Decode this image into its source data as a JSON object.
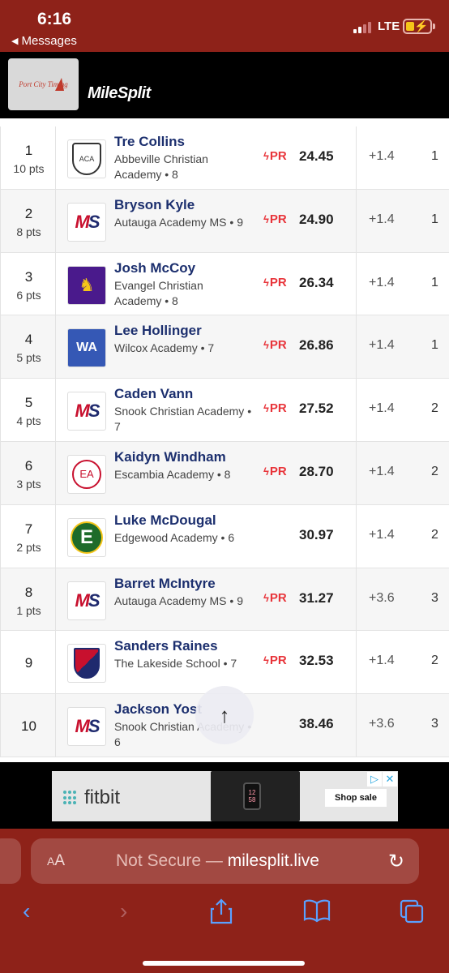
{
  "status": {
    "time": "6:16",
    "back_label": "Messages",
    "network": "LTE"
  },
  "header": {
    "sponsor_logo_text": "Port City Timing",
    "brand": "MileSplit"
  },
  "results": [
    {
      "place": "1",
      "pts": "10 pts",
      "name": "Tre Collins",
      "team": "Abbeville Christian Academy • 8",
      "pr": "PR",
      "mark": "24.45",
      "wind": "+1.4",
      "heat": "1",
      "logo": "abbeville"
    },
    {
      "place": "2",
      "pts": "8 pts",
      "name": "Bryson Kyle",
      "team": "Autauga Academy MS • 9",
      "pr": "PR",
      "mark": "24.90",
      "wind": "+1.4",
      "heat": "1",
      "logo": "ms"
    },
    {
      "place": "3",
      "pts": "6 pts",
      "name": "Josh McCoy",
      "team": "Evangel Christian Academy • 8",
      "pr": "PR",
      "mark": "26.34",
      "wind": "+1.4",
      "heat": "1",
      "logo": "evangel"
    },
    {
      "place": "4",
      "pts": "5 pts",
      "name": "Lee Hollinger",
      "team": "Wilcox Academy • 7",
      "pr": "PR",
      "mark": "26.86",
      "wind": "+1.4",
      "heat": "1",
      "logo": "wilcox"
    },
    {
      "place": "5",
      "pts": "4 pts",
      "name": "Caden Vann",
      "team": "Snook Christian Academy • 7",
      "pr": "PR",
      "mark": "27.52",
      "wind": "+1.4",
      "heat": "2",
      "logo": "ms"
    },
    {
      "place": "6",
      "pts": "3 pts",
      "name": "Kaidyn Windham",
      "team": "Escambia Academy • 8",
      "pr": "PR",
      "mark": "28.70",
      "wind": "+1.4",
      "heat": "2",
      "logo": "escambia"
    },
    {
      "place": "7",
      "pts": "2 pts",
      "name": "Luke McDougal",
      "team": "Edgewood Academy • 6",
      "pr": "",
      "mark": "30.97",
      "wind": "+1.4",
      "heat": "2",
      "logo": "edgewood"
    },
    {
      "place": "8",
      "pts": "1 pts",
      "name": "Barret McIntyre",
      "team": "Autauga Academy MS • 9",
      "pr": "PR",
      "mark": "31.27",
      "wind": "+3.6",
      "heat": "3",
      "logo": "ms"
    },
    {
      "place": "9",
      "pts": "",
      "name": "Sanders Raines",
      "team": "The Lakeside School • 7",
      "pr": "PR",
      "mark": "32.53",
      "wind": "+1.4",
      "heat": "2",
      "logo": "lakeside"
    },
    {
      "place": "10",
      "pts": "",
      "name": "Jackson Yost",
      "team": "Snook Christian Academy • 6",
      "pr": "",
      "mark": "38.46",
      "wind": "+3.6",
      "heat": "3",
      "logo": "ms"
    }
  ],
  "scroll_top_icon": "arrow-up-icon",
  "ad": {
    "brand": "fitbit",
    "cta": "Shop sale",
    "device_time": "12 58"
  },
  "browser": {
    "aa_label": "AA",
    "url_prefix": "Not Secure — ",
    "url_domain": "milesplit.live"
  },
  "colors": {
    "chrome_red": "#8e2219",
    "name_navy": "#1c2f6e",
    "pr_red": "#e8343a"
  }
}
